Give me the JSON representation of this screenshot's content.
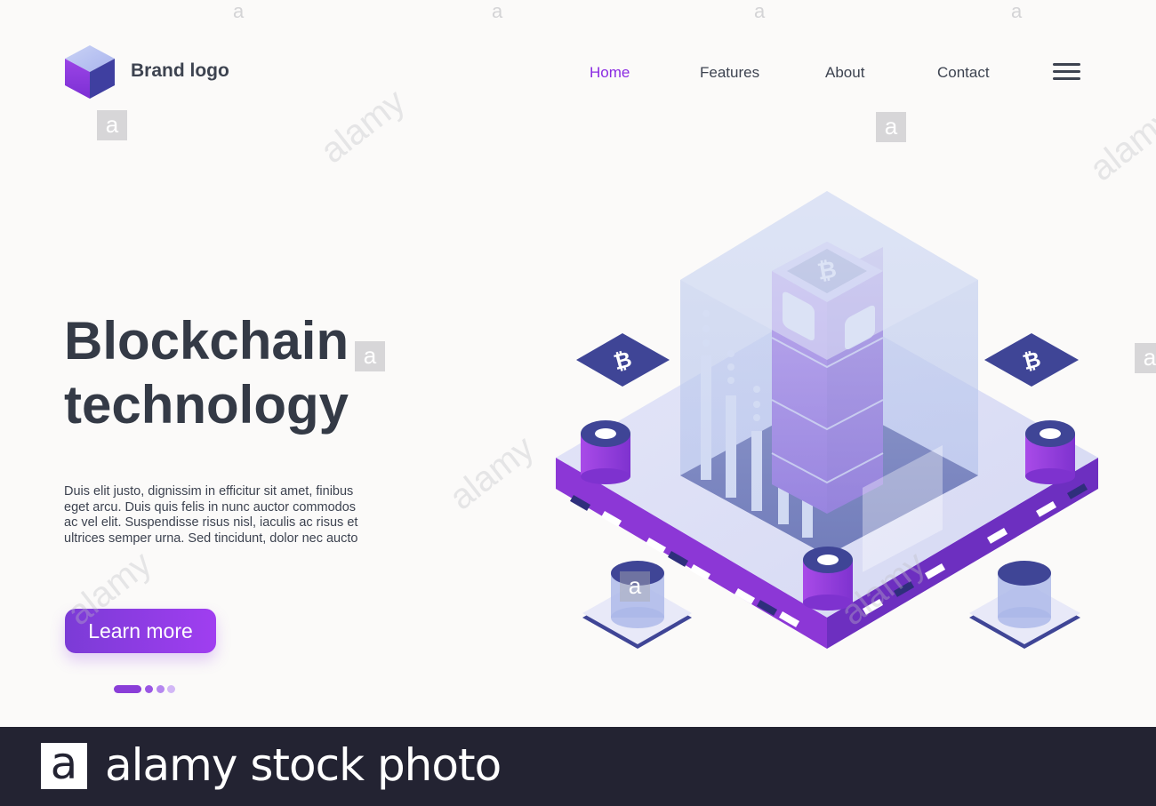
{
  "header": {
    "brand": "Brand logo",
    "nav": [
      {
        "label": "Home",
        "active": true
      },
      {
        "label": "Features",
        "active": false
      },
      {
        "label": "About",
        "active": false
      },
      {
        "label": "Contact",
        "active": false
      }
    ],
    "menu_icon": "hamburger-menu-icon"
  },
  "hero": {
    "title_line1": "Blockchain",
    "title_line2": "technology",
    "description": "Duis elit justo, dignissim in efficitur sit amet, finibus eget arcu. Duis quis felis in nunc auctor commodos ac vel elit. Suspendisse risus nisl, iaculis ac risus et ultrices semper urna. Sed tincidunt, dolor nec aucto",
    "cta_label": "Learn more",
    "pagination_dots": 4,
    "active_dot": 1
  },
  "illustration": {
    "icon": "bitcoin-icon",
    "description_icons": [
      "bitcoin-icon",
      "server-platform-icon"
    ]
  },
  "watermark": {
    "letter": "a",
    "diagonal_text": "alamy",
    "footer_text": "alamy stock photo"
  },
  "colors": {
    "accent": "#8a2be2",
    "purple": "#8a3ed8",
    "dark_blue": "#3f4596",
    "text": "#343a46",
    "footer_bg": "#232332"
  }
}
